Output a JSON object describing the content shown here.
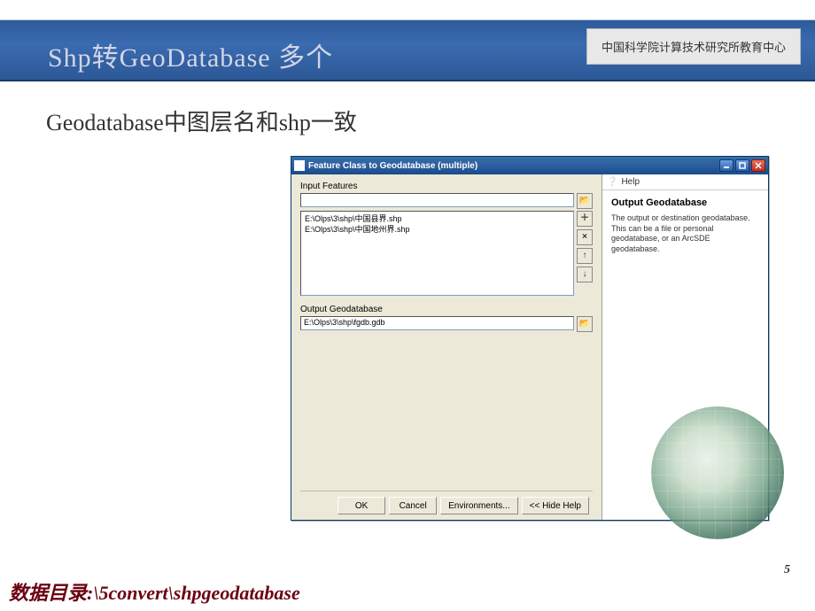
{
  "slide": {
    "title": "Shp转GeoDatabase 多个",
    "badge": "中国科学院计算技术研究所教育中心",
    "subtitle": "Geodatabase中图层名和shp一致",
    "page_number": "5",
    "footer_path": "数据目录:\\5convert\\shpgeodatabase"
  },
  "dialog": {
    "title": "Feature Class to Geodatabase (multiple)",
    "input_features_label": "Input Features",
    "input_list": [
      "E:\\Olps\\3\\shp\\中国县界.shp",
      "E:\\Olps\\3\\shp\\中国地州界.shp"
    ],
    "output_label": "Output Geodatabase",
    "output_value": "E:\\Olps\\3\\shp\\fgdb.gdb",
    "buttons": {
      "ok": "OK",
      "cancel": "Cancel",
      "env": "Environments...",
      "hide_help": "<< Hide Help"
    },
    "side_icons": {
      "browse": "folder-open-icon",
      "add": "plus-icon",
      "remove": "x-icon",
      "up": "arrow-up-icon",
      "down": "arrow-down-icon"
    }
  },
  "help": {
    "panel_label": "Help",
    "title": "Output Geodatabase",
    "body": "The output or destination geodatabase. This can be a file or personal geodatabase, or an ArcSDE geodatabase."
  }
}
